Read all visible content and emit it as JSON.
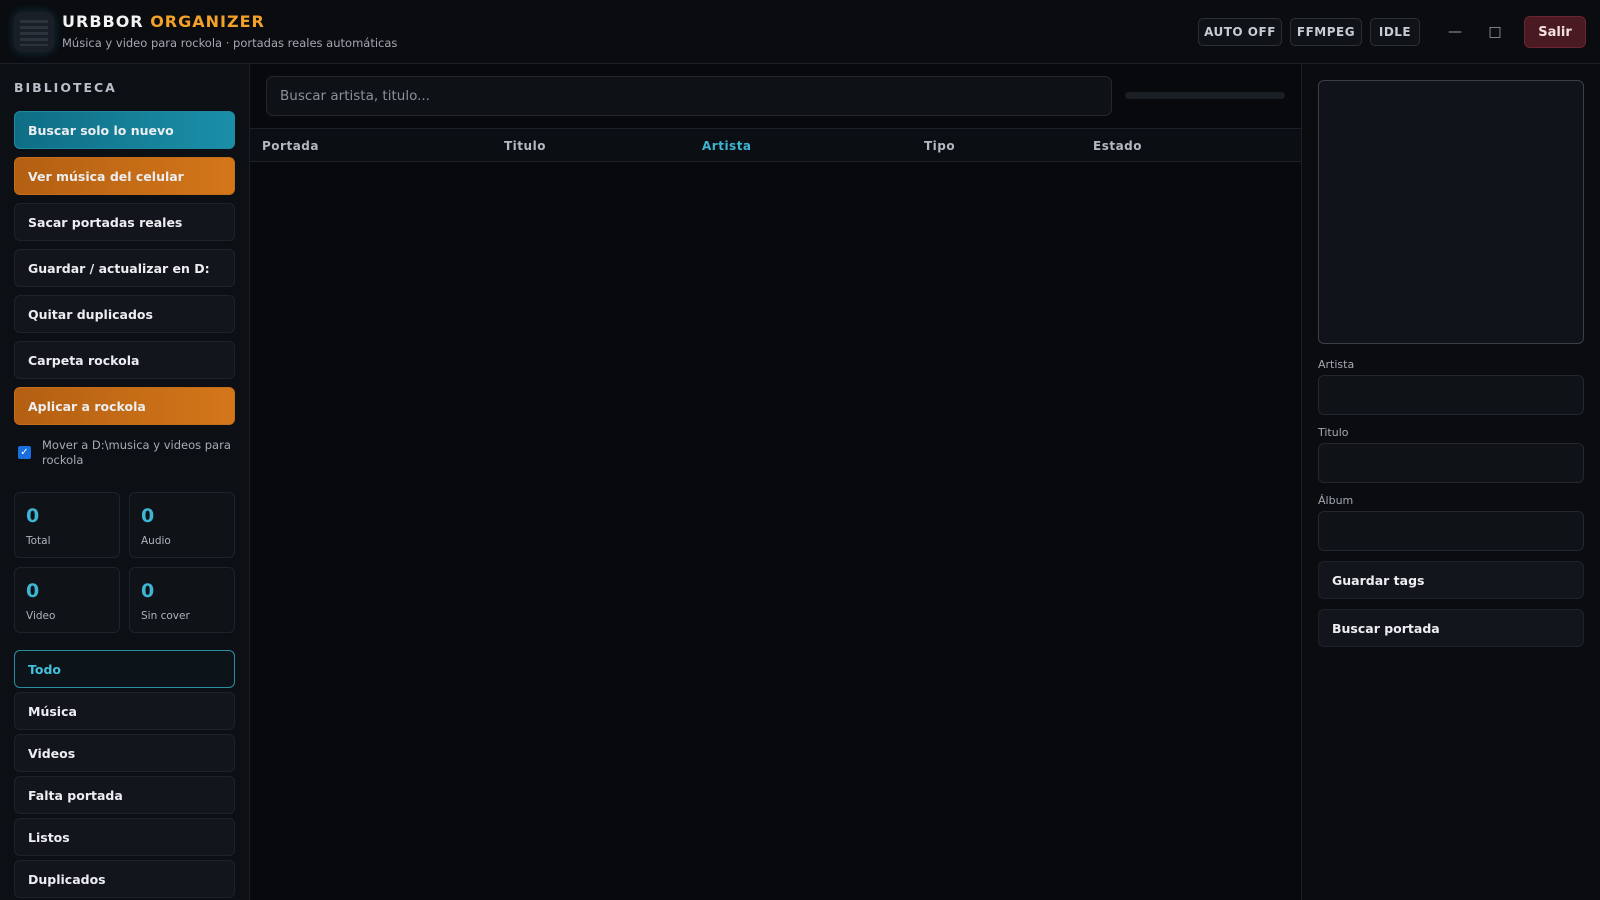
{
  "header": {
    "brand_part1": "URBBOR",
    "brand_part2": "ORGANIZER",
    "subtitle": "Música y video para rockola · portadas reales automáticas",
    "pills": [
      "AUTO OFF",
      "FFMPEG",
      "IDLE"
    ],
    "minimize": "—",
    "maximize": "□",
    "exit": "Salir"
  },
  "sidebar": {
    "title": "BIBLIOTECA",
    "actions": [
      "Buscar solo lo nuevo",
      "Ver música del celular",
      "Sacar portadas reales",
      "Guardar / actualizar en D:",
      "Quitar duplicados",
      "Carpeta rockola",
      "Aplicar a rockola"
    ],
    "move_checkbox": {
      "checked": true,
      "label": "Mover a D:\\musica y videos para rockola"
    },
    "stats": [
      {
        "value": "0",
        "label": "Total"
      },
      {
        "value": "0",
        "label": "Audio"
      },
      {
        "value": "0",
        "label": "Video"
      },
      {
        "value": "0",
        "label": "Sin cover"
      }
    ],
    "filters": [
      "Todo",
      "Música",
      "Videos",
      "Falta portada",
      "Listos",
      "Duplicados"
    ],
    "active_filter": "Todo"
  },
  "main": {
    "search_placeholder": "Buscar artista, titulo...",
    "progress": 0,
    "columns": [
      "Portada",
      "Titulo",
      "Artista",
      "Tipo",
      "Estado"
    ],
    "sorted_column": "Artista",
    "rows": []
  },
  "details": {
    "fields": [
      {
        "label": "Artista",
        "value": ""
      },
      {
        "label": "Titulo",
        "value": ""
      },
      {
        "label": "Álbum",
        "value": ""
      }
    ],
    "buttons": [
      "Guardar tags",
      "Buscar portada"
    ]
  },
  "colors": {
    "accent": "#3fb5d4",
    "brand_orange": "#f4a12a",
    "teal_button": "#1a8fa8",
    "orange_button": "#d4771a",
    "exit_button": "#4a1a22"
  }
}
